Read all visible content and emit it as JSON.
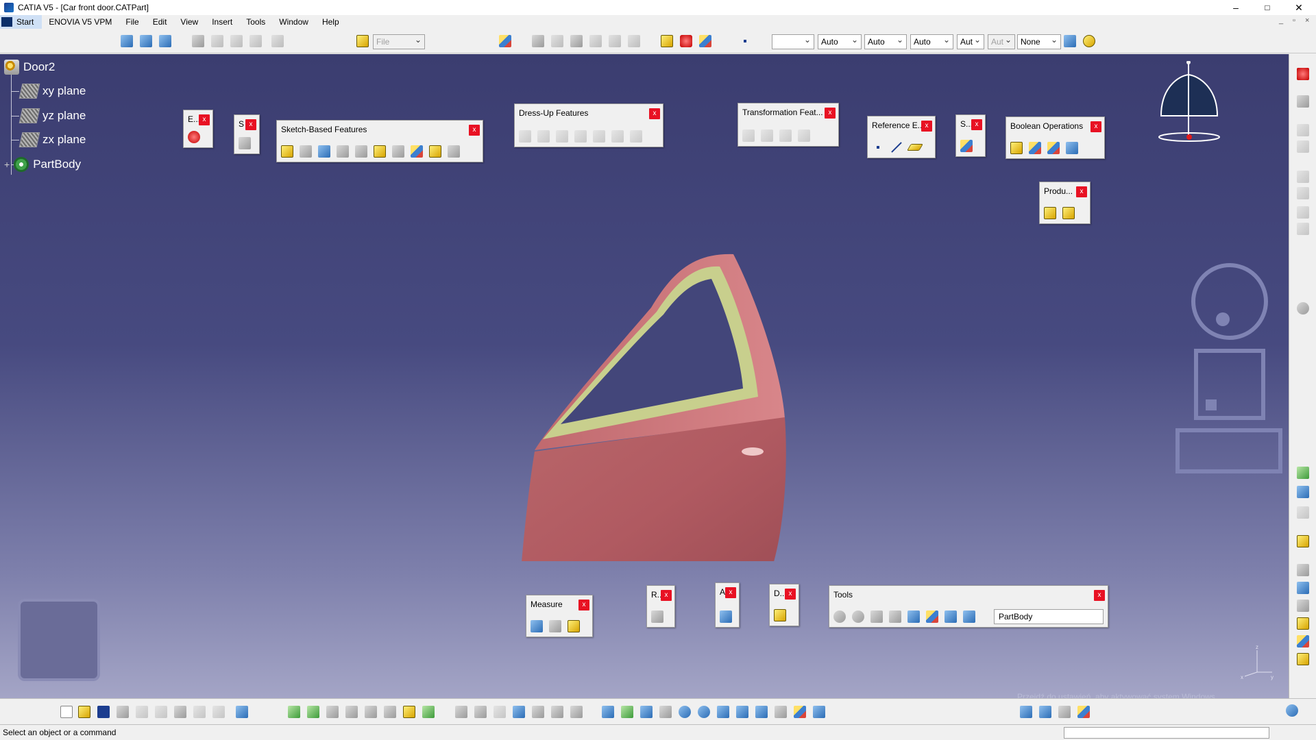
{
  "window": {
    "title": "CATIA V5 - [Car front door.CATPart]",
    "minimize": "–",
    "maximize": "□",
    "close": "✕"
  },
  "menu": {
    "start": "Start",
    "items": [
      "ENOVIA V5 VPM",
      "File",
      "Edit",
      "View",
      "Insert",
      "Tools",
      "Window",
      "Help"
    ]
  },
  "toolbar": {
    "file_combo": "File",
    "combo1": "",
    "combo2": "Auto",
    "combo3": "Auto",
    "combo4": "Auto",
    "combo5": "Aut",
    "combo6": "Aut",
    "combo7": "None"
  },
  "tree": {
    "root": "Door2",
    "items": [
      "xy plane",
      "yz plane",
      "zx plane",
      "PartBody"
    ]
  },
  "floating_toolbars": {
    "exit": "E...",
    "sketch": "S",
    "sketch_based": "Sketch-Based Features",
    "dress_up": "Dress-Up Features",
    "transformation": "Transformation Feat...",
    "reference": "Reference E...",
    "surface": "S...",
    "boolean": "Boolean Operations",
    "product": "Produ...",
    "measure": "Measure",
    "render": "R...",
    "analysis": "A",
    "draft": "D...",
    "tools": "Tools",
    "tools_select": "PartBody",
    "close_label": "x"
  },
  "status": {
    "message": "Select an object or a command",
    "watermark": "Przejdź do ustawień, aby aktywować system Windows."
  },
  "colors": {
    "viewport_top": "#3b3d70",
    "viewport_bottom": "#a4a5c6",
    "door_body": "#b85d63",
    "door_inner": "#c9d08f",
    "close_button": "#e81123"
  }
}
